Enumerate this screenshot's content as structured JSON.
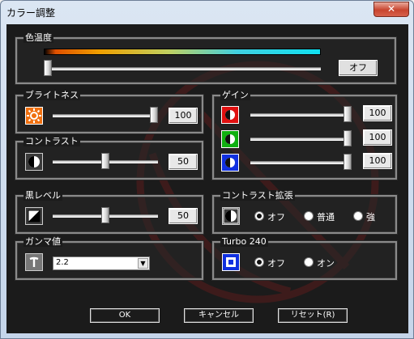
{
  "window": {
    "title": "カラー調整",
    "close_glyph": "✕"
  },
  "color_temp": {
    "label": "色温度",
    "off_button": "オフ"
  },
  "brightness": {
    "label": "ブライトネス",
    "value": "100",
    "level": 1.0
  },
  "contrast": {
    "label": "コントラスト",
    "value": "50",
    "level": 0.5
  },
  "black_level": {
    "label": "黒レベル",
    "value": "50",
    "level": 0.5
  },
  "gamma": {
    "label": "ガンマ値",
    "selected": "2.2"
  },
  "gain": {
    "label": "ゲイン",
    "red": {
      "value": "100",
      "level": 1.0
    },
    "green": {
      "value": "100",
      "level": 1.0
    },
    "blue": {
      "value": "100",
      "level": 1.0
    }
  },
  "contrast_ext": {
    "label": "コントラスト拡張",
    "options": [
      "オフ",
      "普通",
      "強"
    ],
    "selected": 0
  },
  "turbo": {
    "label": "Turbo 240",
    "options": [
      "オフ",
      "オン"
    ],
    "selected": 0
  },
  "buttons": {
    "ok": "OK",
    "cancel": "キャンセル",
    "reset": "リセット(R)"
  },
  "colors": {
    "red": "#e01010",
    "green": "#10b010",
    "blue": "#1030e0",
    "orange": "#f07010"
  }
}
